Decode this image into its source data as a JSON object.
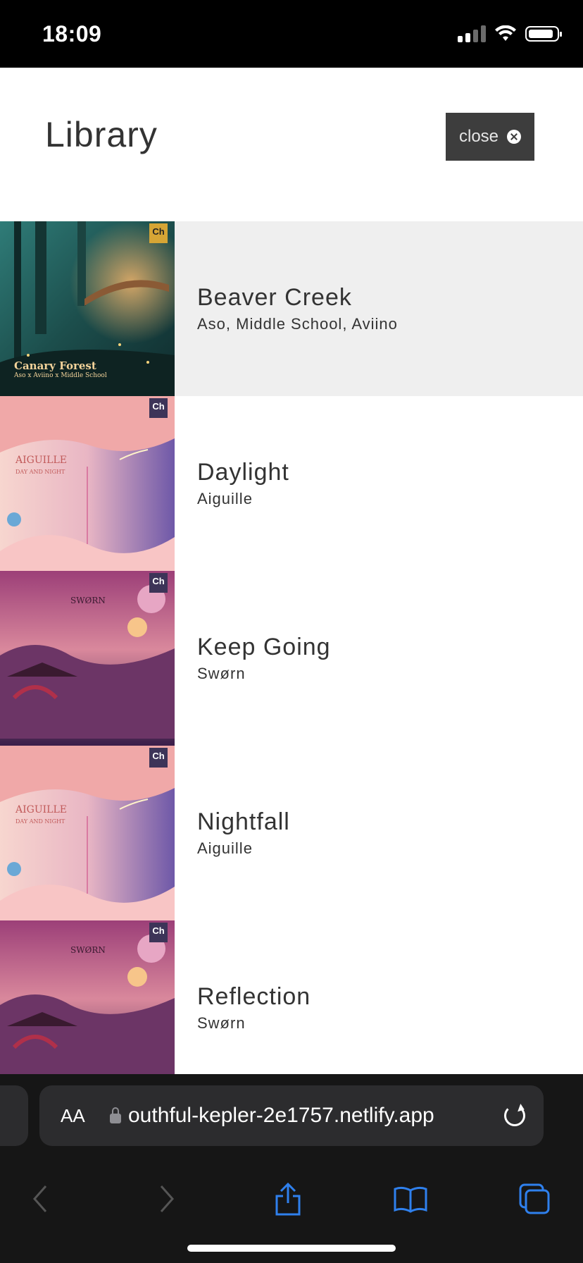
{
  "status_bar": {
    "time": "18:09"
  },
  "header": {
    "title": "Library",
    "close_label": "close"
  },
  "tracks": [
    {
      "title": "Beaver Creek",
      "artist": "Aso, Middle School, Aviino",
      "cover_title": "Canary Forest",
      "cover_sub": "Aso x Aviino x Middle School",
      "active": true
    },
    {
      "title": "Daylight",
      "artist": "Aiguille",
      "active": false
    },
    {
      "title": "Keep Going",
      "artist": "Swørn",
      "active": false
    },
    {
      "title": "Nightfall",
      "artist": "Aiguille",
      "active": false
    },
    {
      "title": "Reflection",
      "artist": "Swørn",
      "active": false
    }
  ],
  "badges": [
    "Ch",
    "Ch",
    "Ch",
    "Ch",
    "Ch"
  ],
  "cover_labels": {
    "aiguille_1": "AIGUILLE",
    "aiguille_2": "DAY AND NIGHT",
    "sworn": "SWØRN"
  },
  "browser": {
    "aa_label": "AA",
    "url": "outhful-kepler-2e1757.netlify.app"
  },
  "colors": {
    "accent_dark": "#3d3d3d",
    "active_row": "#efefef",
    "safari_bg": "#161616",
    "icon_blue": "#2f80ed"
  }
}
